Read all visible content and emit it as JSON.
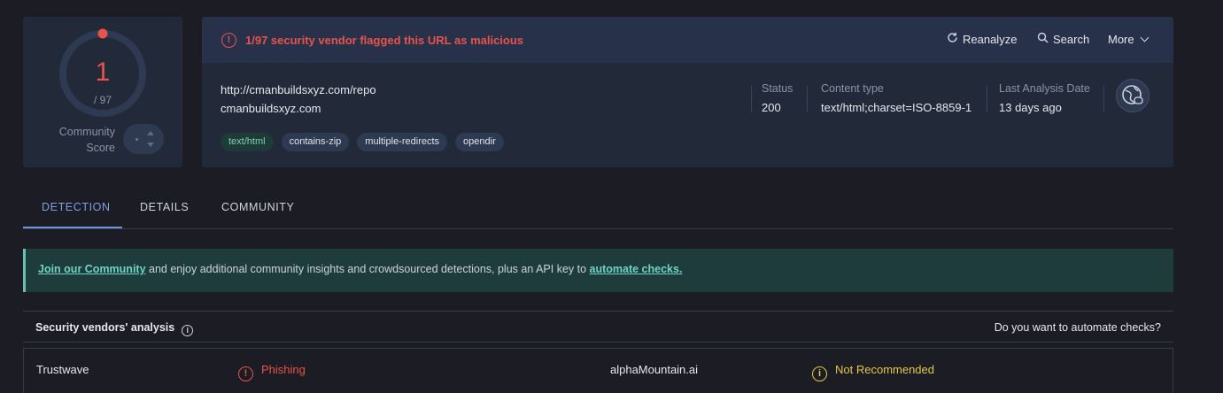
{
  "score": {
    "detections": "1",
    "total": "/ 97",
    "community_label": "Community Score"
  },
  "header": {
    "alert_text": "1/97 security vendor flagged this URL as malicious",
    "reanalyze_label": "Reanalyze",
    "search_label": "Search",
    "more_label": "More"
  },
  "target": {
    "url": "http://cmanbuildsxyz.com/repo",
    "domain": "cmanbuildsxyz.com",
    "tags": [
      "text/html",
      "contains-zip",
      "multiple-redirects",
      "opendir"
    ]
  },
  "meta": {
    "status_label": "Status",
    "status_value": "200",
    "content_type_label": "Content type",
    "content_type_value": "text/html;charset=ISO-8859-1",
    "date_label": "Last Analysis Date",
    "date_value": "13 days ago"
  },
  "tabs": [
    "DETECTION",
    "DETAILS",
    "COMMUNITY"
  ],
  "banner": {
    "link1": "Join our Community",
    "middle": " and enjoy additional community insights and crowdsourced detections, plus an API key to ",
    "link2": "automate checks."
  },
  "vendors": {
    "title": "Security vendors' analysis",
    "automate_question": "Do you want to automate checks?",
    "rows": [
      {
        "vendor1": "Trustwave",
        "result1": "Phishing",
        "vendor2": "alphaMountain.ai",
        "result2": "Not Recommended"
      }
    ]
  },
  "colors": {
    "malicious": "#e8534a",
    "suspicious": "#e7c84a",
    "accent": "#7aa2e3",
    "banner_link": "#6fd3c3"
  }
}
